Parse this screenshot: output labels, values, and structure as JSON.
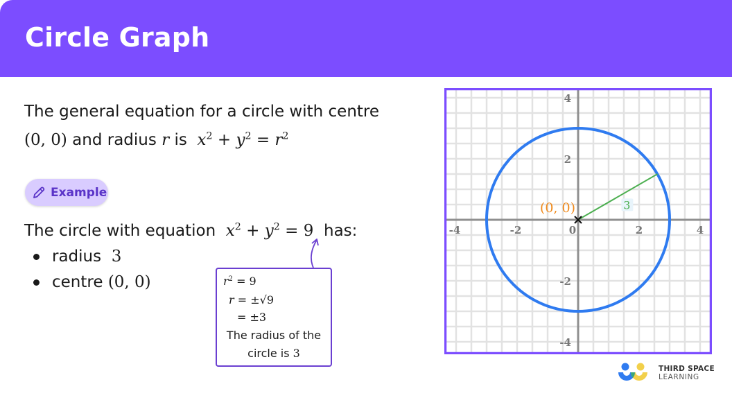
{
  "header": {
    "title": "Circle Graph",
    "background_color": "#7c4dff"
  },
  "intro": {
    "line1": "The general equation for a circle with centre",
    "centre": "(0, 0)",
    "and_radius": "and radius",
    "r": "r",
    "is": "is",
    "equation": {
      "x": "x",
      "y": "y",
      "r": "r",
      "exp": "2",
      "plus": "+",
      "equals": "="
    }
  },
  "example": {
    "label": "Example",
    "icon": "pencil-icon"
  },
  "statement": {
    "prefix": "The circle with equation",
    "equation": {
      "x": "x",
      "y": "y",
      "exp": "2",
      "plus": "+",
      "equals": "=",
      "rhs": "9"
    },
    "suffix": "has:"
  },
  "bullets": [
    {
      "label": "radius",
      "value": "3"
    },
    {
      "label": "centre",
      "value": "(0, 0)"
    }
  ],
  "note": {
    "line1_lhs": "r",
    "line1_exp": "2",
    "line1_rhs": "= 9",
    "line2_lhs": "r",
    "line2_rhs": "= ±√9",
    "line3": "= ±3",
    "text1": "The radius of the",
    "text2": "circle is",
    "text2_value": "3"
  },
  "chart_data": {
    "type": "scatter",
    "title": "",
    "xlabel": "",
    "ylabel": "",
    "xlim": [
      -4.3,
      4.3
    ],
    "ylim": [
      -4.3,
      4.3
    ],
    "grid": true,
    "grid_step": 0.5,
    "x_ticks": [
      -4,
      -2,
      0,
      2,
      4
    ],
    "y_ticks": [
      -4,
      -2,
      2,
      4
    ],
    "x_tick_labels": [
      "-4",
      "-2",
      "0",
      "2",
      "4"
    ],
    "y_tick_labels": [
      "-4",
      "-2",
      "2",
      "4"
    ],
    "circle": {
      "center": [
        0,
        0
      ],
      "radius": 3,
      "color": "#2f7bf0"
    },
    "centre_point": {
      "x": 0,
      "y": 0,
      "marker": "x",
      "label": "(0, 0)",
      "label_color": "#f08a1c"
    },
    "radius_segment": {
      "from": [
        0,
        0
      ],
      "to": [
        2.6,
        1.5
      ],
      "label": "3",
      "color": "#4caf50"
    },
    "frame_color": "#7c4dff"
  },
  "logo": {
    "line1": "THIRD SPACE",
    "line2": "LEARNING"
  }
}
